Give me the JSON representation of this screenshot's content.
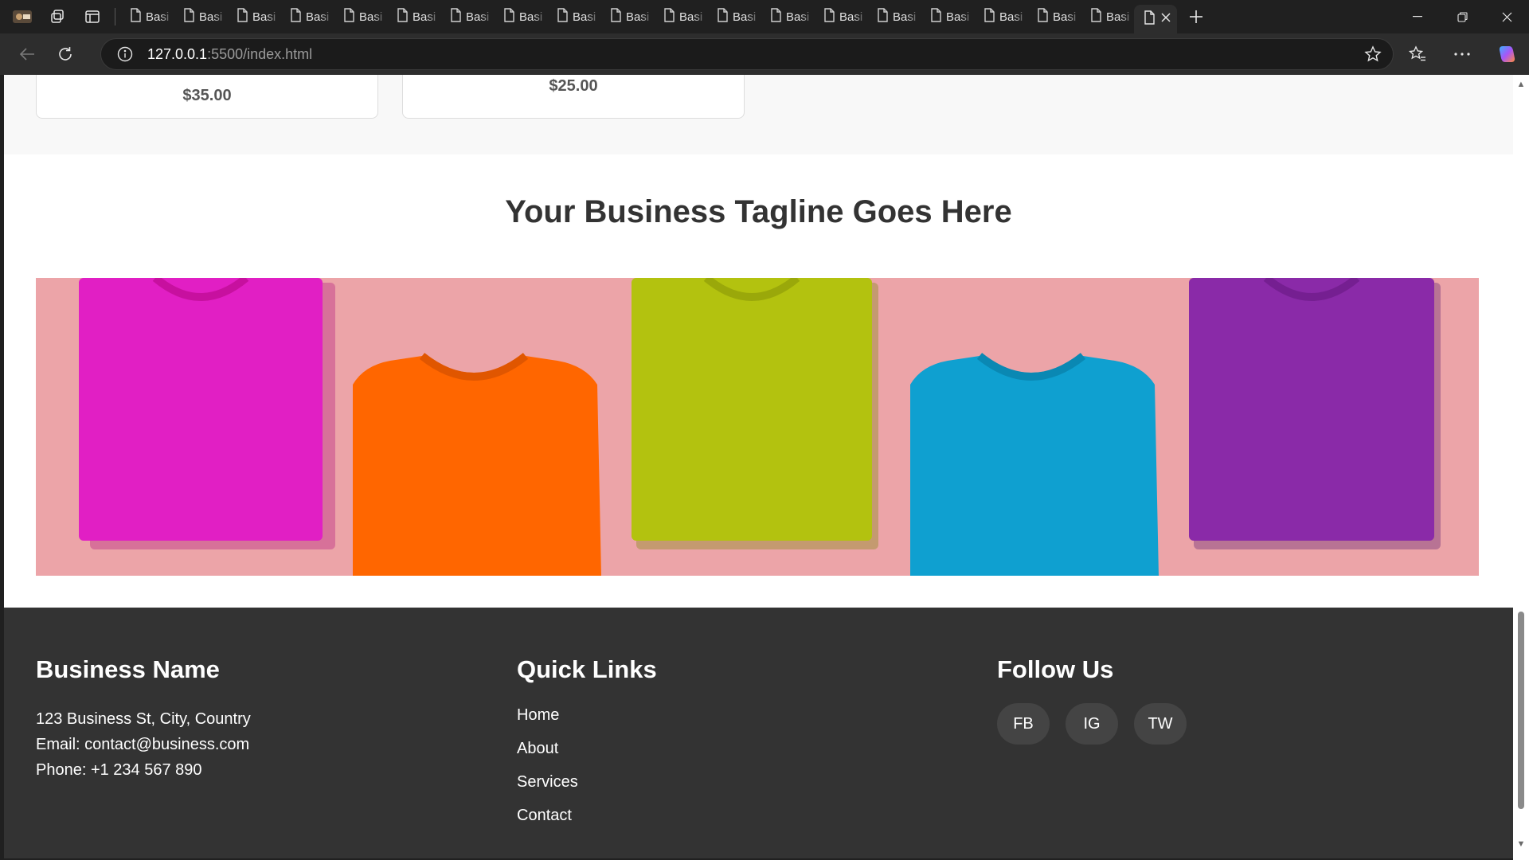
{
  "browser": {
    "tab_label": "Basi",
    "url_host": "127.0.0.1",
    "url_path": ":5500/index.html"
  },
  "products": {
    "prices": [
      "$35.00",
      "$25.00"
    ]
  },
  "tagline": "Your Business Tagline Goes Here",
  "banner": {
    "background_color": "#eca4a8",
    "shirt_colors": [
      "#e11fc4",
      "#ff6600",
      "#b3c20f",
      "#0fa0d0",
      "#8a2aa8"
    ]
  },
  "footer": {
    "business": {
      "heading": "Business Name",
      "address": "123 Business St, City, Country",
      "email": "Email: contact@business.com",
      "phone": "Phone: +1 234 567 890"
    },
    "links": {
      "heading": "Quick Links",
      "items": [
        "Home",
        "About",
        "Services",
        "Contact"
      ]
    },
    "social": {
      "heading": "Follow Us",
      "items": [
        "FB",
        "IG",
        "TW"
      ]
    }
  }
}
